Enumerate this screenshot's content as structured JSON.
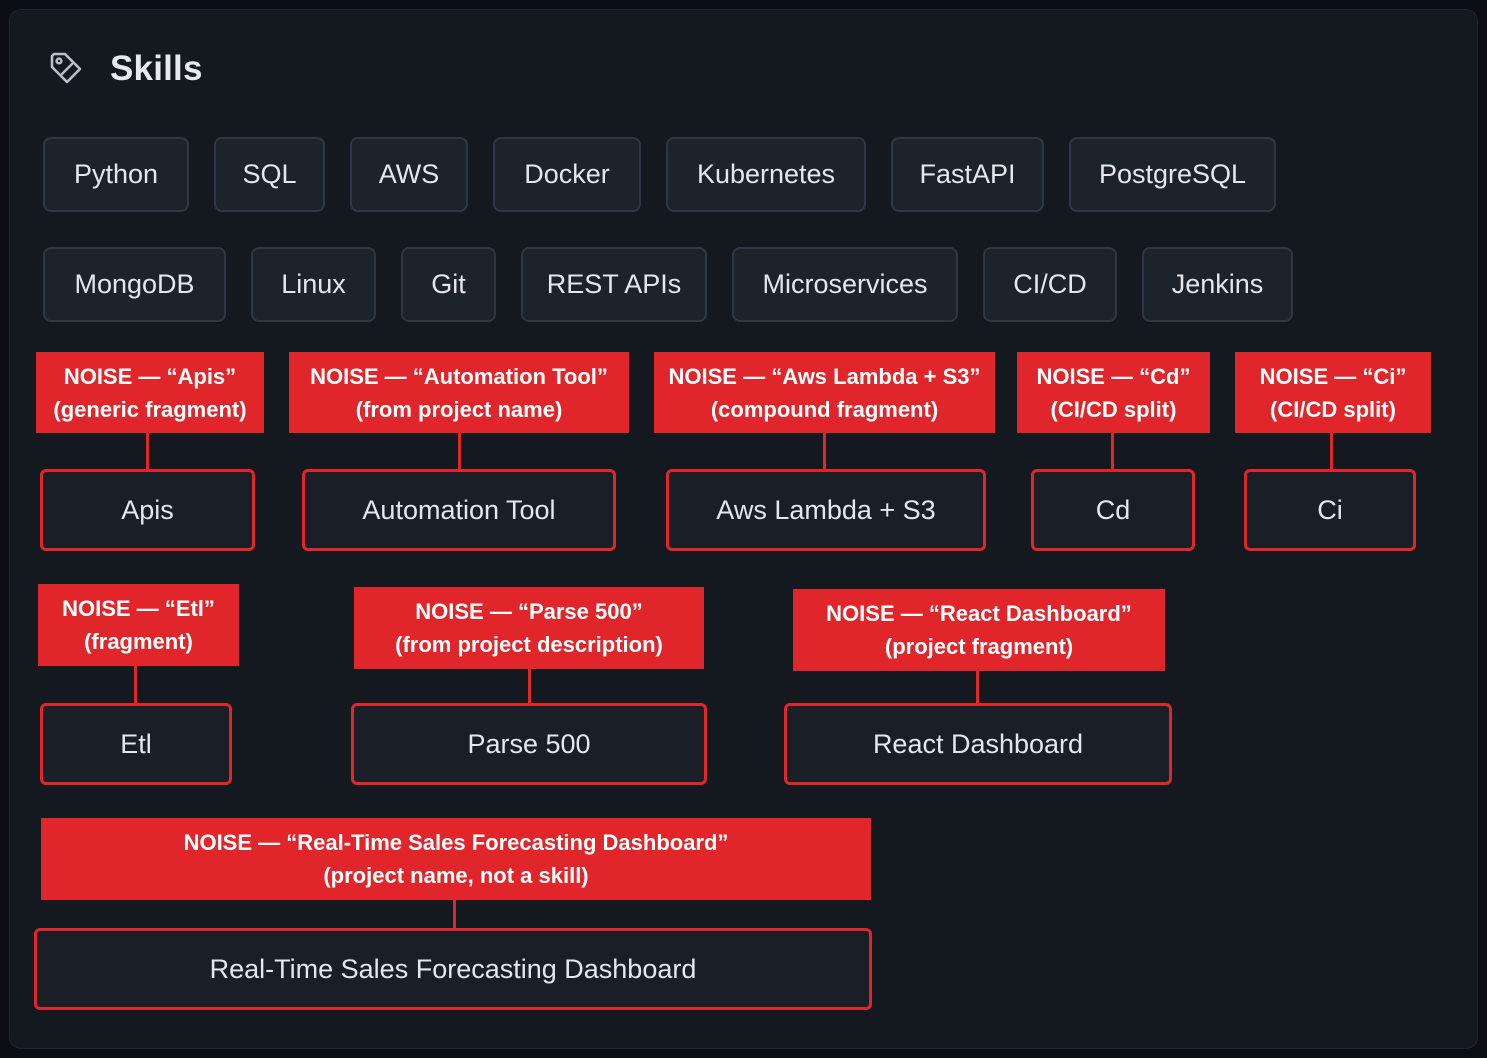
{
  "header": {
    "title": "Skills",
    "icon": "tag-icon"
  },
  "colors": {
    "background": "#141920",
    "chip": "#1d232b",
    "chip_border": "#2f3742",
    "noise": "#e1262b",
    "text": "#e4e7ec"
  },
  "skills_row1": [
    "Python",
    "SQL",
    "AWS",
    "Docker",
    "Kubernetes",
    "FastAPI",
    "PostgreSQL"
  ],
  "skills_row2": [
    "MongoDB",
    "Linux",
    "Git",
    "REST APIs",
    "Microservices",
    "CI/CD",
    "Jenkins"
  ],
  "noise_items": [
    {
      "skill": "Apis",
      "note_line1": "NOISE — “Apis”",
      "note_line2": "(generic fragment)"
    },
    {
      "skill": "Automation Tool",
      "note_line1": "NOISE — “Automation Tool”",
      "note_line2": "(from project name)"
    },
    {
      "skill": "Aws Lambda + S3",
      "note_line1": "NOISE — “Aws Lambda + S3”",
      "note_line2": "(compound fragment)"
    },
    {
      "skill": "Cd",
      "note_line1": "NOISE — “Cd”",
      "note_line2": "(CI/CD split)"
    },
    {
      "skill": "Ci",
      "note_line1": "NOISE — “Ci”",
      "note_line2": "(CI/CD split)"
    },
    {
      "skill": "Etl",
      "note_line1": "NOISE — “Etl”",
      "note_line2": "(fragment)"
    },
    {
      "skill": "Parse 500",
      "note_line1": "NOISE — “Parse 500”",
      "note_line2": "(from project description)"
    },
    {
      "skill": "React Dashboard",
      "note_line1": "NOISE — “React Dashboard”",
      "note_line2": "(project fragment)"
    },
    {
      "skill": "Real-Time Sales Forecasting Dashboard",
      "note_line1": "NOISE — “Real-Time Sales Forecasting Dashboard”",
      "note_line2": "(project name, not a skill)"
    }
  ]
}
